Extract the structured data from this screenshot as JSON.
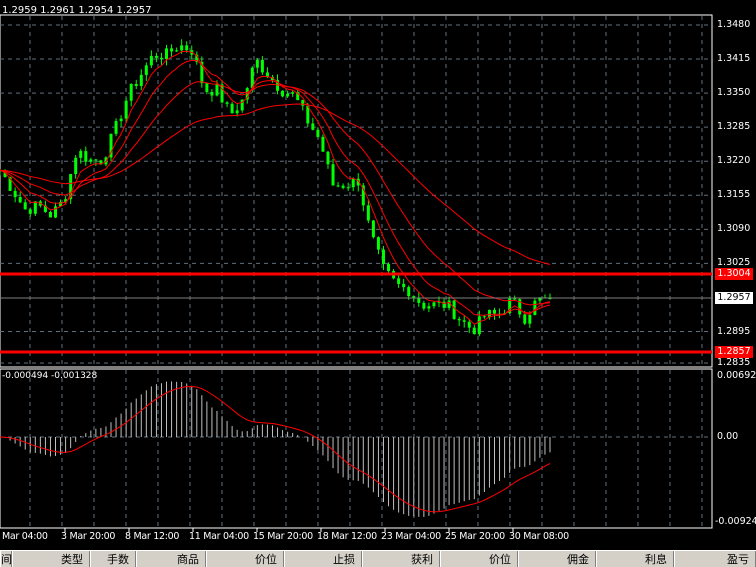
{
  "chart_data": {
    "type": "candlestick",
    "ohlc_readout": "1.2959 1.2961 1.2954 1.2957",
    "price_ticks": [
      "1.3480",
      "1.3415",
      "1.3350",
      "1.3285",
      "1.3220",
      "1.3155",
      "1.3090",
      "1.3025",
      "1.2895",
      "1.2835"
    ],
    "price_range": [
      1.2835,
      1.348
    ],
    "closes": [
      1.3203,
      1.3165,
      1.3127,
      1.3136,
      1.3117,
      1.3146,
      1.3241,
      1.3222,
      1.3222,
      1.328,
      1.3346,
      1.3385,
      1.3423,
      1.3423,
      1.3442,
      1.3432,
      1.3356,
      1.3356,
      1.3308,
      1.3337,
      1.3413,
      1.3385,
      1.3356,
      1.3346,
      1.3299,
      1.3261,
      1.3175,
      1.3175,
      1.3184,
      1.3079,
      1.3012,
      1.2984,
      1.2974,
      1.2946,
      1.2946,
      1.2946,
      1.2917,
      1.2898,
      1.2927,
      1.2927,
      1.2955,
      1.2921,
      1.2955,
      1.2957
    ],
    "current_price": "1.2957",
    "hlines": [
      {
        "label": "1.3004",
        "color": "#ff0000"
      },
      {
        "label": "1.2857",
        "color": "#ff0000"
      }
    ],
    "candle_color": "#00ff00",
    "ma_color": "#ff0000",
    "macd": {
      "readout": "-0.000494 -0.001328",
      "ticks": [
        "0.00692",
        "0.00",
        "-0.00924"
      ],
      "range": [
        -0.00924,
        0.00692
      ],
      "histogram_color": "#c0c0c0",
      "signal_color": "#ff0000"
    },
    "time_labels": [
      "Mar 04:00",
      "3 Mar 20:00",
      "8 Mar 12:00",
      "11 Mar 04:00",
      "15 Mar 20:00",
      "18 Mar 12:00",
      "23 Mar 04:00",
      "25 Mar 20:00",
      "30 Mar 08:00"
    ],
    "grid": true
  },
  "table": {
    "headers": [
      "间",
      "类型",
      "手数",
      "商品",
      "价位",
      "止损",
      "获利",
      "价位",
      "佣金",
      "利息",
      "盈亏"
    ]
  }
}
